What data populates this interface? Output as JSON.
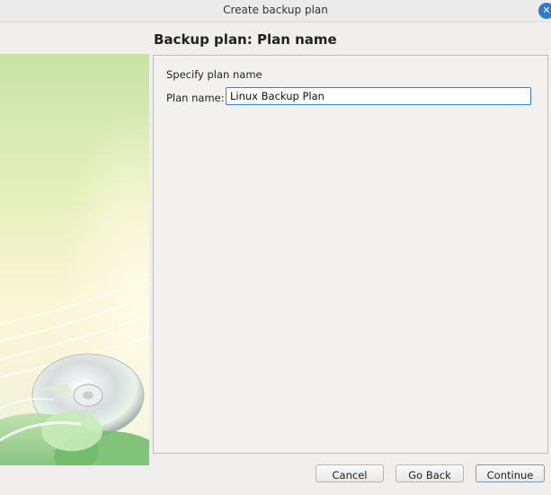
{
  "window": {
    "title": "Create backup plan",
    "close_symbol": "✕"
  },
  "page": {
    "heading": "Backup plan: Plan name"
  },
  "form": {
    "section_label": "Specify plan name",
    "plan_name_label": "Plan name:",
    "plan_name_value": "Linux Backup Plan"
  },
  "buttons": {
    "cancel": "Cancel",
    "back": "Go Back",
    "continue": "Continue"
  },
  "colors": {
    "accent": "#2e7bd6",
    "input_focus_border": "#3c80d8"
  },
  "icons": {
    "close": "close-icon",
    "sidebar_art": "disc-illustration"
  }
}
